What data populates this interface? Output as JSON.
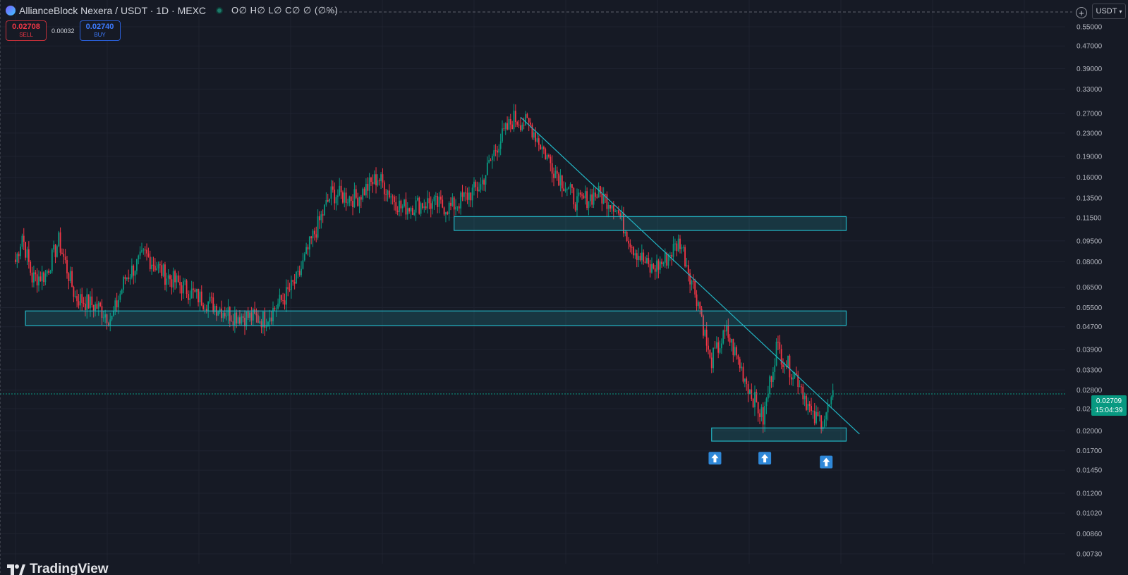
{
  "header": {
    "symbol_title": "AllianceBlock Nexera / USDT · 1D · MEXC",
    "ohlc_text": "O∅ H∅ L∅ C∅ ∅ (∅%)"
  },
  "trade": {
    "sell_price": "0.02708",
    "sell_label": "SELL",
    "spread": "0.00032",
    "buy_price": "0.02740",
    "buy_label": "BUY"
  },
  "toolbar": {
    "currency": "USDT",
    "plus_symbol": "+"
  },
  "price_axis": {
    "labels": [
      "0.55000",
      "0.47000",
      "0.39000",
      "0.33000",
      "0.27000",
      "0.23000",
      "0.19000",
      "0.16000",
      "0.13500",
      "0.11500",
      "0.09500",
      "0.08000",
      "0.06500",
      "0.05500",
      "0.04700",
      "0.03900",
      "0.03300",
      "0.02800",
      "0.02400",
      "0.02000",
      "0.01700",
      "0.01450",
      "0.01200",
      "0.01020",
      "0.00860",
      "0.00730"
    ]
  },
  "last_price": {
    "price": "0.02709",
    "countdown": "15:04:39"
  },
  "brand": {
    "name": "TradingView"
  },
  "colors": {
    "background": "#161a25",
    "up": "#089981",
    "down": "#f23645",
    "zone": "#22b5c4",
    "grid": "#1f2330"
  },
  "chart_data": {
    "type": "candlestick",
    "symbol": "AllianceBlock Nexera / USDT",
    "interval": "1D",
    "exchange": "MEXC",
    "scale": "log",
    "ylim": [
      0.0068,
      0.56
    ],
    "waypoints": [
      [
        0,
        0.08
      ],
      [
        4,
        0.1
      ],
      [
        10,
        0.07
      ],
      [
        18,
        0.072
      ],
      [
        26,
        0.095
      ],
      [
        36,
        0.06
      ],
      [
        50,
        0.055
      ],
      [
        58,
        0.05
      ],
      [
        66,
        0.07
      ],
      [
        78,
        0.085
      ],
      [
        90,
        0.072
      ],
      [
        110,
        0.06
      ],
      [
        130,
        0.052
      ],
      [
        150,
        0.05
      ],
      [
        162,
        0.06
      ],
      [
        170,
        0.07
      ],
      [
        178,
        0.095
      ],
      [
        190,
        0.14
      ],
      [
        205,
        0.135
      ],
      [
        218,
        0.16
      ],
      [
        232,
        0.125
      ],
      [
        248,
        0.13
      ],
      [
        262,
        0.125
      ],
      [
        270,
        0.135
      ],
      [
        280,
        0.15
      ],
      [
        290,
        0.21
      ],
      [
        300,
        0.26
      ],
      [
        310,
        0.245
      ],
      [
        322,
        0.18
      ],
      [
        338,
        0.13
      ],
      [
        350,
        0.14
      ],
      [
        360,
        0.13
      ],
      [
        372,
        0.09
      ],
      [
        382,
        0.075
      ],
      [
        390,
        0.08
      ],
      [
        400,
        0.095
      ],
      [
        412,
        0.055
      ],
      [
        418,
        0.035
      ],
      [
        428,
        0.045
      ],
      [
        442,
        0.028
      ],
      [
        450,
        0.022
      ],
      [
        458,
        0.04
      ],
      [
        464,
        0.035
      ],
      [
        472,
        0.03
      ],
      [
        480,
        0.022
      ],
      [
        486,
        0.022
      ],
      [
        492,
        0.026
      ]
    ],
    "zones": [
      {
        "from_index": 264,
        "to_index": 500,
        "low": 0.1035,
        "high": 0.116
      },
      {
        "from_index": 6,
        "to_index": 500,
        "low": 0.0475,
        "high": 0.0535
      },
      {
        "from_index": 419,
        "to_index": 500,
        "low": 0.0184,
        "high": 0.0205
      }
    ],
    "trendline": {
      "from_index": 304,
      "from_price": 0.262,
      "to_index": 508,
      "to_price": 0.0195
    },
    "markers": [
      {
        "index": 421,
        "price": 0.016,
        "type": "arrow-up"
      },
      {
        "index": 451,
        "price": 0.016,
        "type": "arrow-up"
      },
      {
        "index": 488,
        "price": 0.0155,
        "type": "arrow-up"
      }
    ]
  }
}
